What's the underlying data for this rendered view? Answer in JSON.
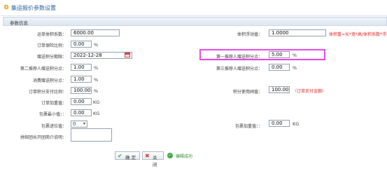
{
  "page": {
    "title": "集运报价参数设置"
  },
  "panel": {
    "header": "参数信息"
  },
  "fields": {
    "volume_coef": {
      "label": "运单体积系数：",
      "value": "6000.00"
    },
    "volume_float": {
      "label": "体积浮动值：",
      "value": "1.0000",
      "hint": "体积重=长*宽*高/体积系数*浮动"
    },
    "order_insurance": {
      "label": "订单保险比例：",
      "value": "0.00",
      "unit": "%"
    },
    "gift_points_date": {
      "label": "赠送积分期限：",
      "value": "2022-12-28"
    },
    "first_referrer_points": {
      "label": "第一推荐人赠送积分点：",
      "value": "5.00",
      "unit": "%"
    },
    "second_referrer_points": {
      "label": "第二推荐人赠送积分点：",
      "value": "1.00",
      "unit": "%"
    },
    "third_referrer_points": {
      "label": "第三推荐人赠送积分点：",
      "value": "0.00",
      "unit": "%"
    },
    "consume_points": {
      "label": "消费赠送积分点：",
      "value": "1.00",
      "unit": "%"
    },
    "order_points_pay_ratio": {
      "label": "订单积分支付比例：",
      "value": "100.00",
      "unit": "%"
    },
    "points_threshold": {
      "label": "积分使用阀值：",
      "value": "100.00",
      "hint": "（订单支付金额）"
    },
    "order_add_weight": {
      "label": "订单加重值：",
      "value": "0.00",
      "unit": "KG"
    },
    "package_min": {
      "label": "包裹最小值：：",
      "value": "0.00",
      "unit": "KG"
    },
    "package_carry": {
      "label": "包裹进位值：",
      "value": "0"
    },
    "package_add_weight": {
      "label": "包裹加重值：：",
      "value": "0.00",
      "unit": "KG"
    },
    "free_ship_desc": {
      "label": "拼邮团长开团简介说明：",
      "value": ""
    }
  },
  "buttons": {
    "confirm": "确 定",
    "close": "关 闭"
  },
  "status": {
    "message": "编辑成功"
  },
  "colors": {
    "accent": "#1f5c99",
    "highlight": "#e040e0",
    "warning": "#e02020",
    "success": "#2d8a2d"
  }
}
